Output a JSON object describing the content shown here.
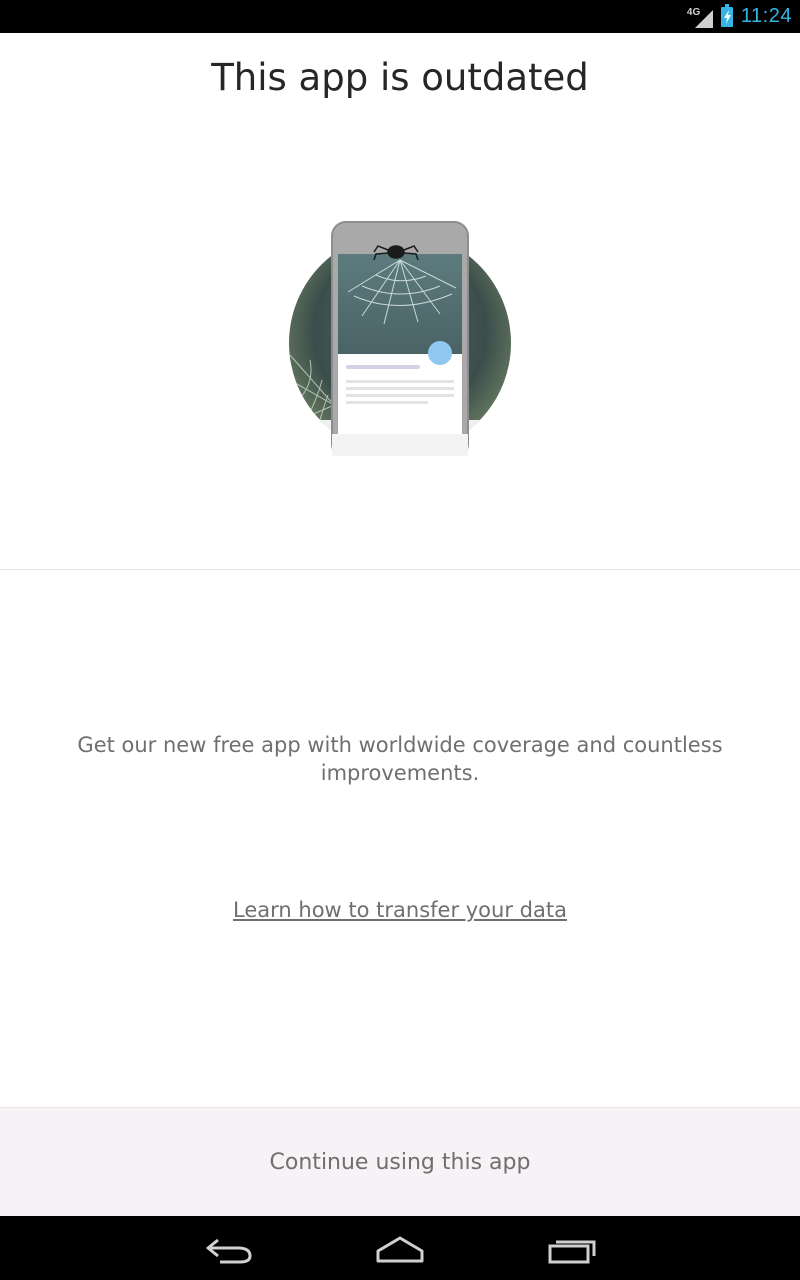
{
  "status_bar": {
    "network": "4G",
    "time": "11:24",
    "accent_color": "#33b5e5"
  },
  "title": "This app is outdated",
  "message": "Get our new free app with worldwide coverage and countless improvements.",
  "learn_link": "Learn how to transfer your data",
  "continue_label": "Continue using this app",
  "nav": {
    "back_icon": "back-icon",
    "home_icon": "home-icon",
    "recents_icon": "recents-icon"
  }
}
